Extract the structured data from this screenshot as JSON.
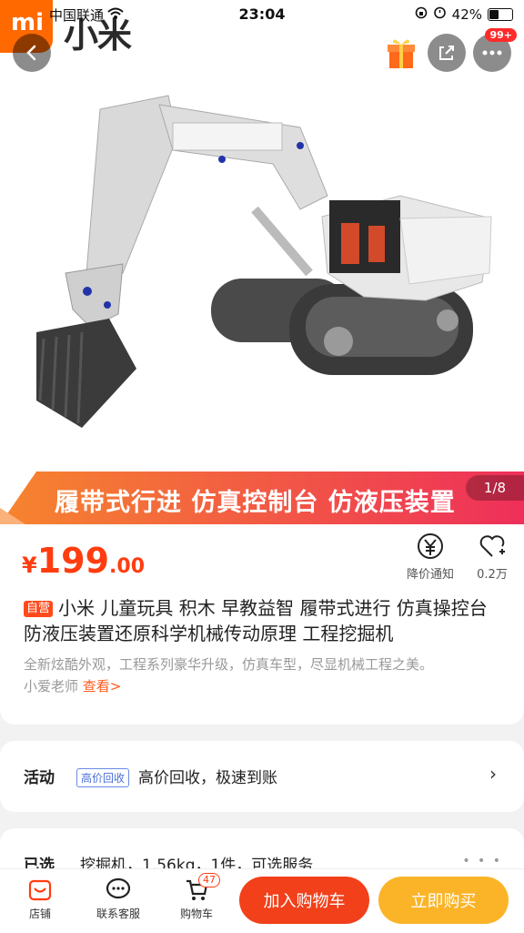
{
  "status_bar": {
    "carrier": "中国联通",
    "time": "23:04",
    "battery": "42%"
  },
  "brand": {
    "logo_text": "mi",
    "name": "小米"
  },
  "header": {
    "cart_badge": "99+"
  },
  "banner": {
    "text": "履带式行进 仿真控制台 仿液压装置",
    "pager": "1/8"
  },
  "product": {
    "currency": "¥",
    "price_int": "199",
    "price_dec": ".00",
    "self_run_tag": "自营",
    "title": "小米 儿童玩具 积木 早教益智 履带式进行 仿真操控台 防液压装置还原科学机械传动原理 工程挖掘机",
    "subtitle": "全新炫酷外观，工程系列豪华升级，仿真车型，尽显机械工程之美。",
    "recommender": "小爱老师",
    "view_link": "查看>"
  },
  "price_actions": {
    "price_alert": "降价通知",
    "favorite_count": "0.2万"
  },
  "activity": {
    "label": "活动",
    "tag": "高价回收",
    "text": "高价回收，极速到账"
  },
  "selected": {
    "label": "已选",
    "text": "挖掘机，1.56kg，1件，可选服务"
  },
  "bottom_bar": {
    "store": "店铺",
    "service": "联系客服",
    "cart": "购物车",
    "cart_count": "47",
    "add_to_cart": "加入购物车",
    "buy_now": "立即购买"
  },
  "colors": {
    "accent": "#ff3d10",
    "buy": "#fbb428",
    "brand_orange": "#ff6900"
  }
}
